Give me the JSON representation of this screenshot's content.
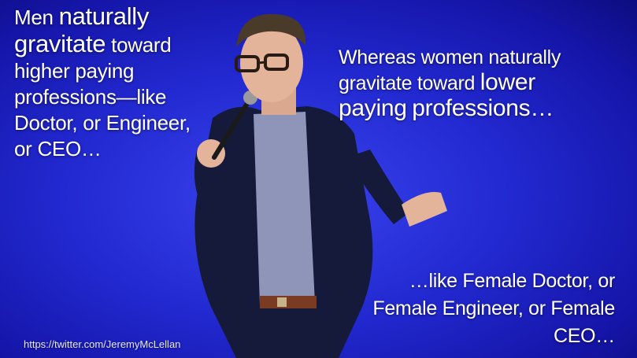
{
  "captions": {
    "left": {
      "line1": "Men",
      "line2": "naturally",
      "line3": "gravitate",
      "line4": "toward higher paying professions—like Doctor, or Engineer, or CEO…"
    },
    "right": {
      "line1": "Whereas women naturally gravitate toward",
      "line2": "lower paying",
      "line3": "professions…"
    },
    "bottom": "…like Female Doctor, or Female Engineer, or Female CEO…"
  },
  "url": "https://twitter.com/JeremyMcLellan",
  "colors": {
    "background": "#2229d0",
    "text": "#ffffff"
  }
}
